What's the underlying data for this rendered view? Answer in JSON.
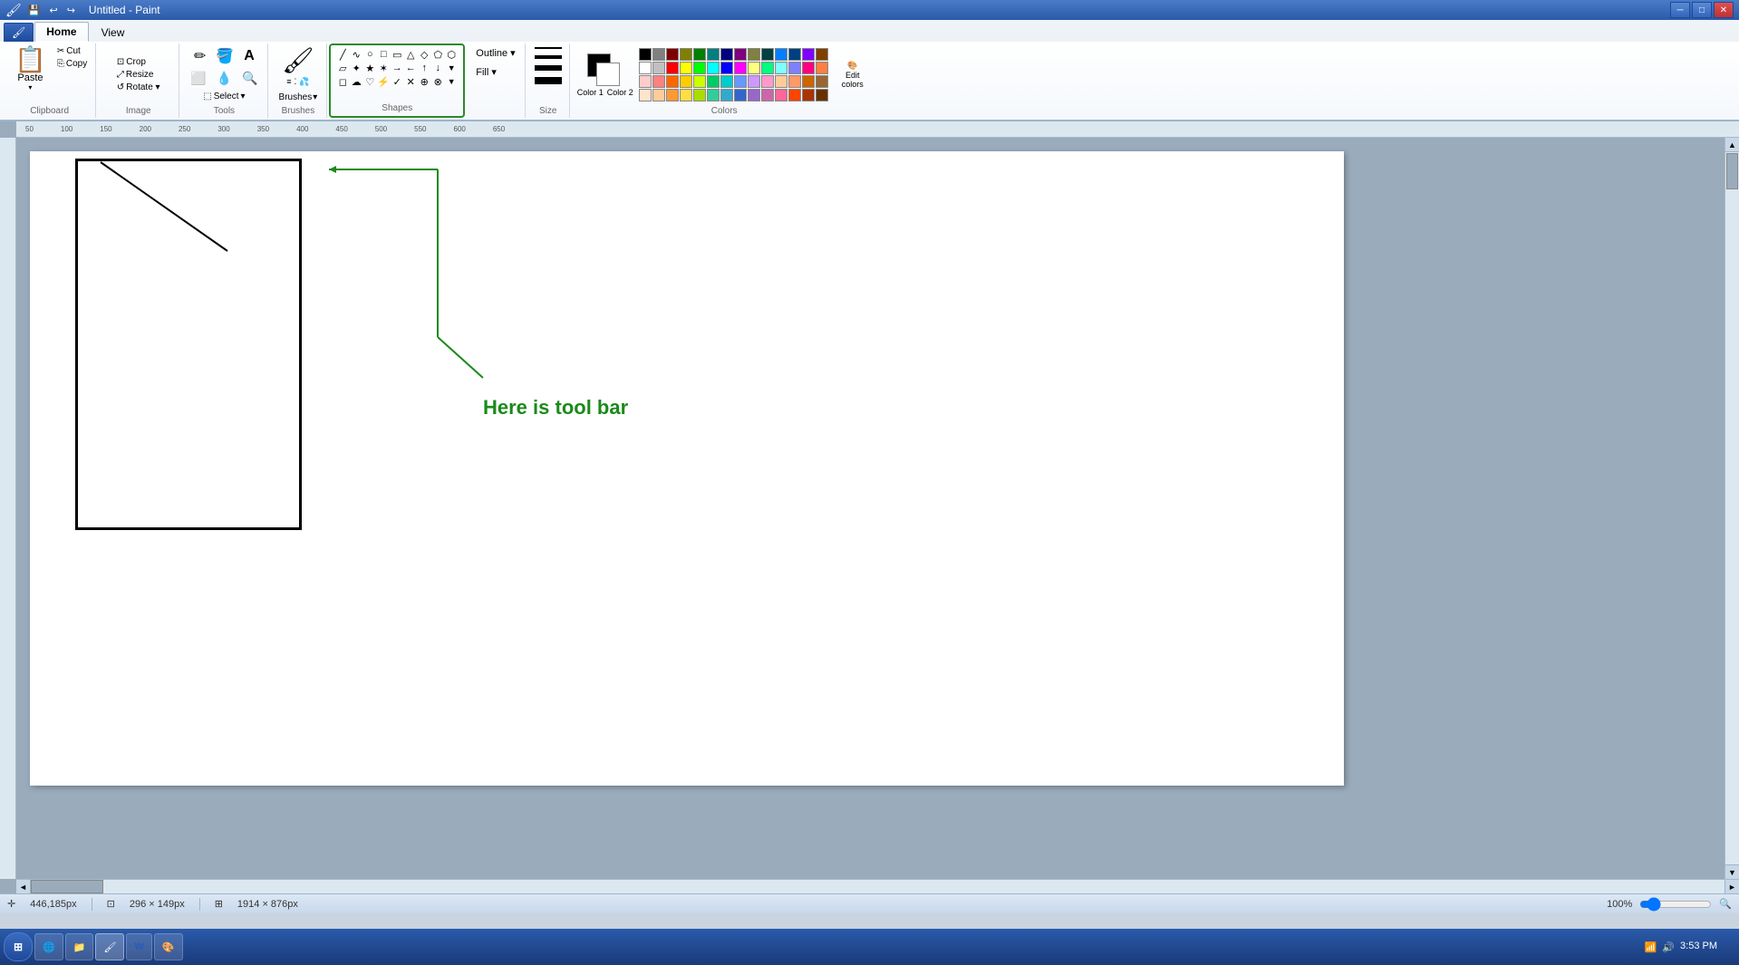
{
  "window": {
    "title": "Untitled - Paint",
    "controls": [
      "minimize",
      "maximize",
      "close"
    ]
  },
  "ribbon": {
    "tabs": [
      "Home",
      "View"
    ],
    "active_tab": "Home",
    "groups": {
      "clipboard": {
        "label": "Clipboard",
        "paste": "Paste",
        "cut": "Cut",
        "copy": "Copy"
      },
      "image": {
        "label": "Image",
        "crop": "Crop",
        "resize": "Resize",
        "rotate": "Rotate ▾"
      },
      "tools": {
        "label": "Tools",
        "select": "Select",
        "tools_list": [
          "pencil",
          "fill",
          "text",
          "eraser",
          "picker",
          "magnifier"
        ]
      },
      "shapes": {
        "label": "Shapes",
        "highlighted": true
      },
      "outline": {
        "label": "Outline ▾",
        "fill": "Fill ▾"
      },
      "size": {
        "label": "Size"
      },
      "colors": {
        "label": "Colors",
        "color1_label": "Color 1",
        "color2_label": "Color 2",
        "edit_label": "Edit colors"
      }
    }
  },
  "canvas": {
    "annotation_text": "Here is tool bar",
    "annotation_text_color": "#1a8a1a"
  },
  "status_bar": {
    "cursor_pos": "446,185px",
    "selection_size": "296 × 149px",
    "image_size": "1914 × 876px",
    "zoom": "100%"
  },
  "taskbar": {
    "start_label": "⊞",
    "apps": [
      {
        "label": "Chrome",
        "icon": "🌐"
      },
      {
        "label": "Files",
        "icon": "📁"
      },
      {
        "label": "Paint",
        "icon": "🖌"
      },
      {
        "label": "Word",
        "icon": "W"
      },
      {
        "label": "Paint2",
        "icon": "🎨"
      }
    ],
    "time": "3:53 PM",
    "date": "3:53 PM"
  },
  "colors": {
    "swatches_row1": [
      "#000000",
      "#808080",
      "#800000",
      "#808000",
      "#008000",
      "#008080",
      "#000080",
      "#800080",
      "#808040",
      "#004040",
      "#0080ff",
      "#004080",
      "#8000ff",
      "#804000"
    ],
    "swatches_row2": [
      "#ffffff",
      "#c0c0c0",
      "#ff0000",
      "#ffff00",
      "#00ff00",
      "#00ffff",
      "#0000ff",
      "#ff00ff",
      "#ffff80",
      "#00ff80",
      "#80ffff",
      "#8080ff",
      "#ff0080",
      "#ff8040"
    ],
    "swatches_row3": [
      "#ffcccc",
      "#ff8080",
      "#ff6600",
      "#ffcc00",
      "#ccff00",
      "#00cc66",
      "#00cccc",
      "#6699ff",
      "#cc99ff",
      "#ff99cc",
      "#ffcc99",
      "#ff9966",
      "#cc6600",
      "#996633"
    ],
    "swatches_row4": [
      "#ffe4cc",
      "#ffcc99",
      "#ff9933",
      "#ffdd44",
      "#aadd00",
      "#33cc99",
      "#33aacc",
      "#3366cc",
      "#9966cc",
      "#cc66aa",
      "#ff6699",
      "#ff4400",
      "#aa3300",
      "#663300"
    ]
  }
}
